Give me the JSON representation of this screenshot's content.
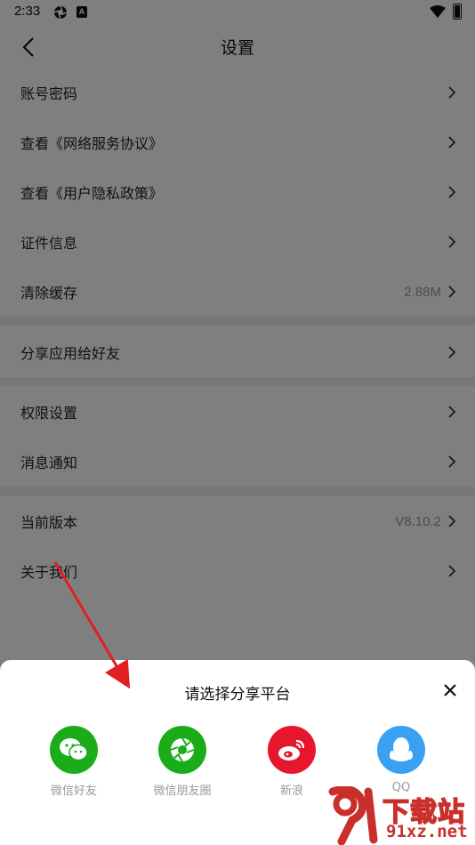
{
  "status_bar": {
    "time": "2:33",
    "badge_letter": "A"
  },
  "header": {
    "title": "设置"
  },
  "settings": {
    "group1": [
      {
        "label": "账号密码",
        "value": ""
      },
      {
        "label": "查看《网络服务协议》",
        "value": ""
      },
      {
        "label": "查看《用户隐私政策》",
        "value": ""
      },
      {
        "label": "证件信息",
        "value": ""
      },
      {
        "label": "清除缓存",
        "value": "2.88M"
      }
    ],
    "group2": [
      {
        "label": "分享应用给好友",
        "value": ""
      }
    ],
    "group3": [
      {
        "label": "权限设置",
        "value": ""
      },
      {
        "label": "消息通知",
        "value": ""
      }
    ],
    "group4": [
      {
        "label": "当前版本",
        "value": "V8.10.2"
      },
      {
        "label": "关于我们",
        "value": ""
      }
    ]
  },
  "share_sheet": {
    "title": "请选择分享平台",
    "options": [
      {
        "label": "微信好友",
        "icon": "wechat-icon",
        "color": "#1aad19"
      },
      {
        "label": "微信朋友圈",
        "icon": "moments-icon",
        "color": "#1aad19"
      },
      {
        "label": "新浪",
        "icon": "weibo-icon",
        "color": "#e6162d"
      },
      {
        "label": "QQ",
        "icon": "qq-icon",
        "color": "#3ca0f0"
      }
    ]
  },
  "watermark": {
    "text": "下载站",
    "url": "91xz.net"
  },
  "colors": {
    "overlay": "#000000",
    "annotation_arrow": "#e02020",
    "watermark": "#c9302c"
  }
}
